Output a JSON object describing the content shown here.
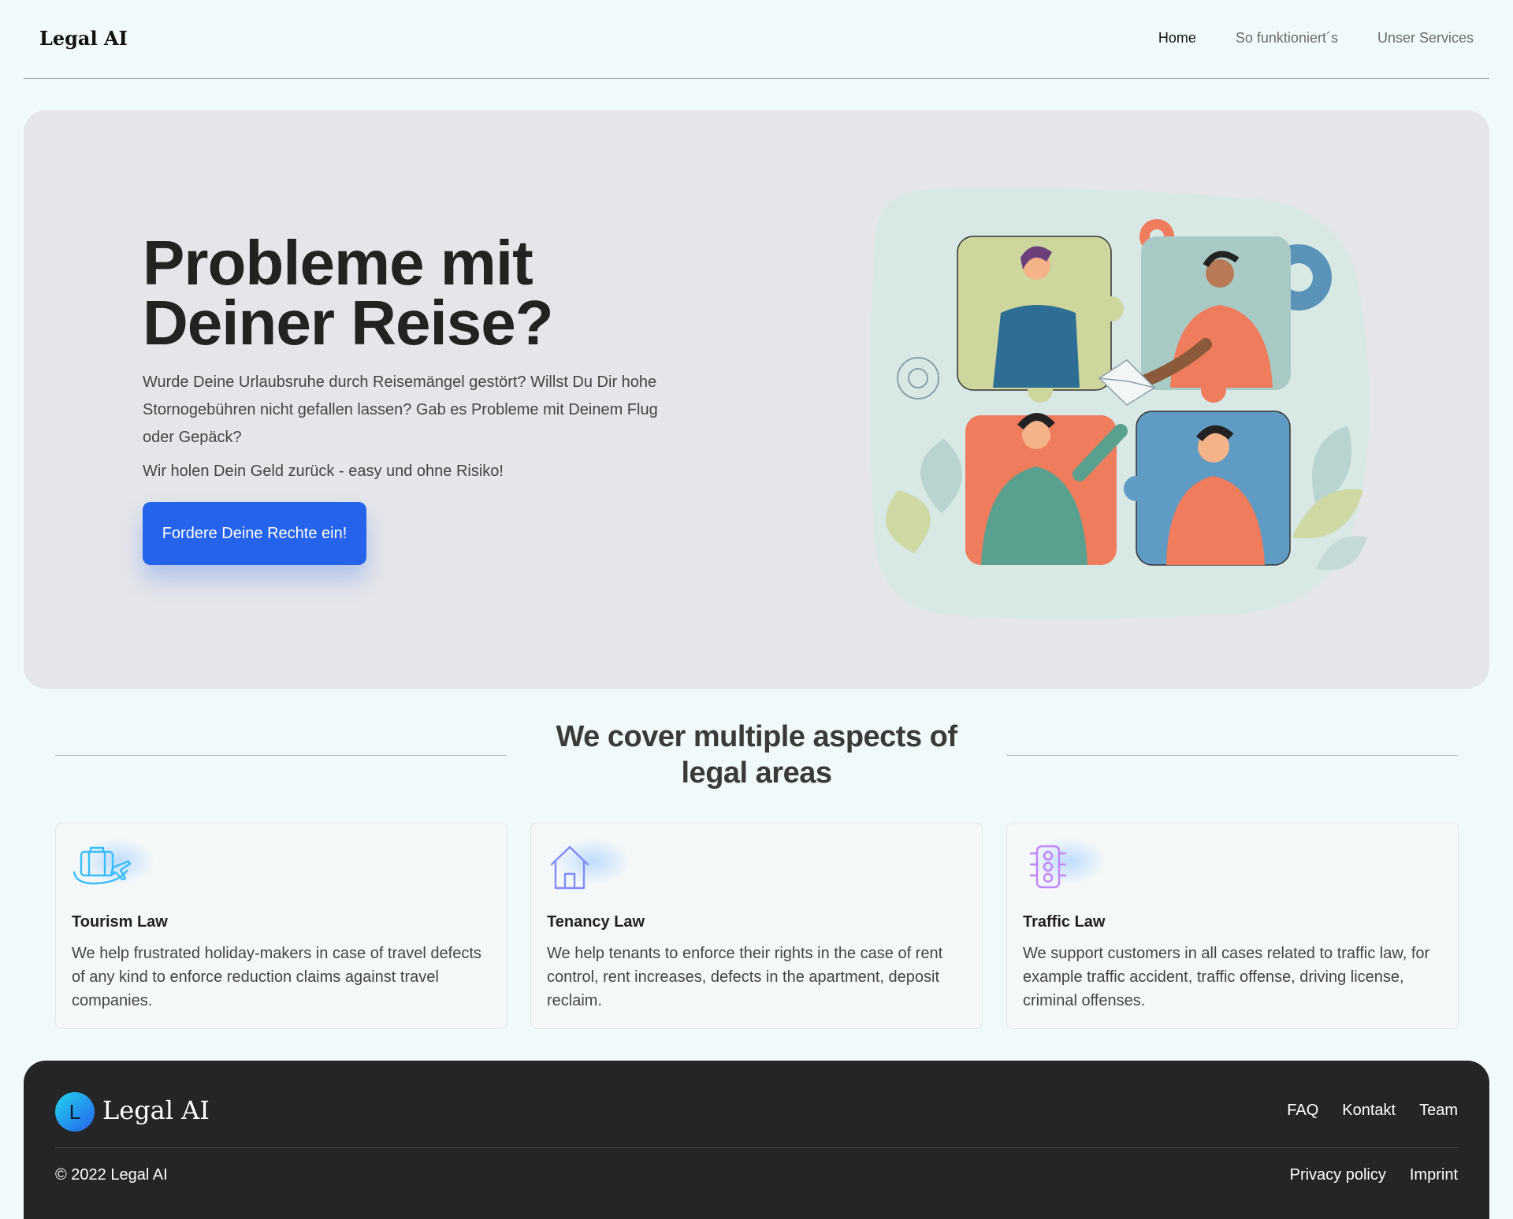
{
  "nav": {
    "logo": "Legal AI",
    "links": [
      "Home",
      "So funktioniert´s",
      "Unser Services"
    ]
  },
  "hero": {
    "title_line1": "Probleme mit",
    "title_line2": "Deiner Reise?",
    "description": "Wurde Deine Urlaubsruhe durch Reisemängel gestört? Willst Du Dir hohe Stornogebühren nicht gefallen lassen? Gab es Probleme mit Deinem Flug oder Gepäck?",
    "subline": "Wir holen Dein Geld zurück - easy und ohne Risiko!",
    "cta_label": "Fordere Deine Rechte ein!"
  },
  "section": {
    "title": "We cover multiple aspects of legal areas"
  },
  "cards": [
    {
      "icon": "suitcase-plane-icon",
      "title": "Tourism Law",
      "text": "We help frustrated holiday-makers in case of travel defects of any kind to enforce reduction claims against travel companies."
    },
    {
      "icon": "house-icon",
      "title": "Tenancy Law",
      "text": "We help tenants to enforce their rights in the case of rent control, rent increases, defects in the apartment, deposit reclaim."
    },
    {
      "icon": "traffic-light-icon",
      "title": "Traffic Law",
      "text": "We support customers in all cases related to traffic law, for example traffic accident, traffic offense, driving license, criminal offenses."
    }
  ],
  "footer": {
    "logo_letter": "L",
    "logo": "Legal AI",
    "links": [
      "FAQ",
      "Kontakt",
      "Team"
    ],
    "copyright": "© 2022 Legal AI",
    "legal": [
      "Privacy policy",
      "Imprint"
    ]
  },
  "colors": {
    "accent": "#2563eb",
    "hero_bg": "#e5e6ea",
    "page_bg": "#f1fafa",
    "footer_bg": "#242526"
  }
}
